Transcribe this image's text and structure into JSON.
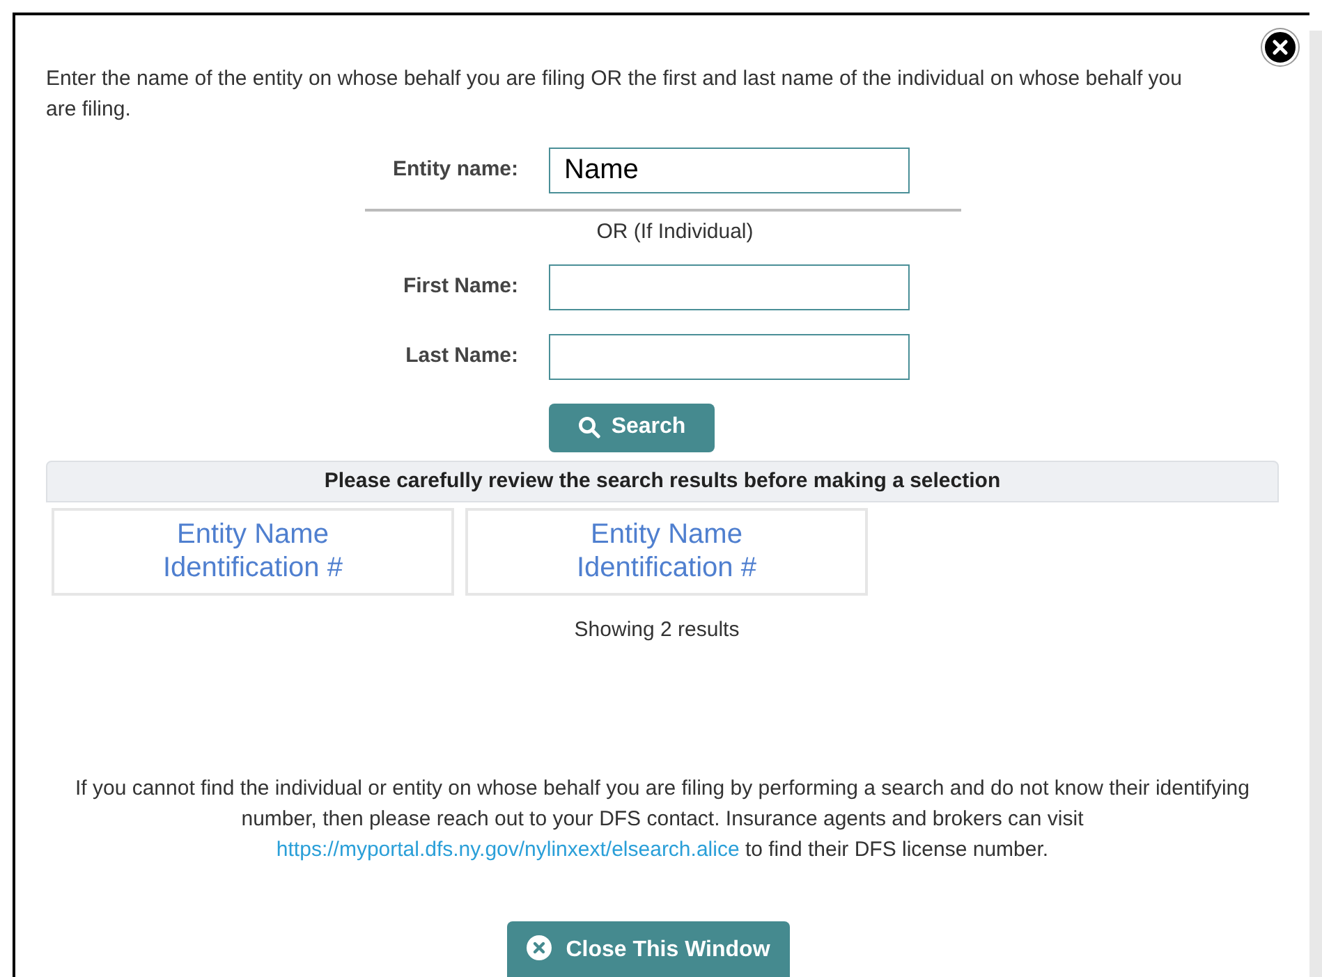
{
  "intro": "Enter the name of the entity on whose behalf you are filing OR the first and last name of the individual on whose behalf you are filing.",
  "entity_field": {
    "label": "Entity name:",
    "value": "Name"
  },
  "separator": "OR (If Individual)",
  "individual_fields": [
    {
      "label": "First Name:"
    },
    {
      "label": "Last Name:"
    }
  ],
  "search_button": "Search",
  "results_header": "Please carefully review the search results before making a selection",
  "results": [
    {
      "lines": [
        "Entity Name",
        "Identification #"
      ]
    },
    {
      "lines": [
        "Entity Name",
        "Identification #"
      ]
    }
  ],
  "results_count": "Showing 2 results",
  "help": {
    "text_before": "If you cannot find the individual or entity on whose behalf you are filing by performing a search and do not know their identifying number, then please reach out to your DFS contact. Insurance agents and brokers can visit",
    "link": "https://myportal.dfs.ny.gov/nylinxext/elsearch.alice",
    "text_after": "to find their DFS license number."
  },
  "close_button": "Close This Window"
}
